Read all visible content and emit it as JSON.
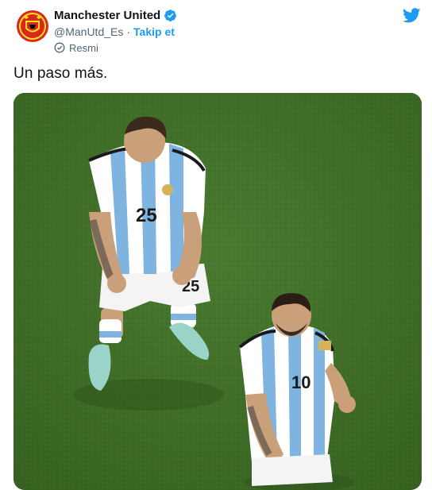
{
  "account": {
    "display_name": "Manchester United",
    "handle": "@ManUtd_Es",
    "separator": "·",
    "follow_label": "Takip et",
    "badge_label": "Resmi",
    "verified_color": "#1d9bf0"
  },
  "tweet": {
    "text": "Un paso más."
  },
  "media": {
    "kind": "photo",
    "player_left_number": "25",
    "player_right_number": "10"
  },
  "icons": {
    "brand": "twitter-bird-icon",
    "verified": "verified-badge-icon",
    "official": "official-check-icon"
  },
  "colors": {
    "accent": "#1d9bf0",
    "text_primary": "#0f1419",
    "text_secondary": "#536471",
    "pitch_green": "#3f6b2a"
  }
}
